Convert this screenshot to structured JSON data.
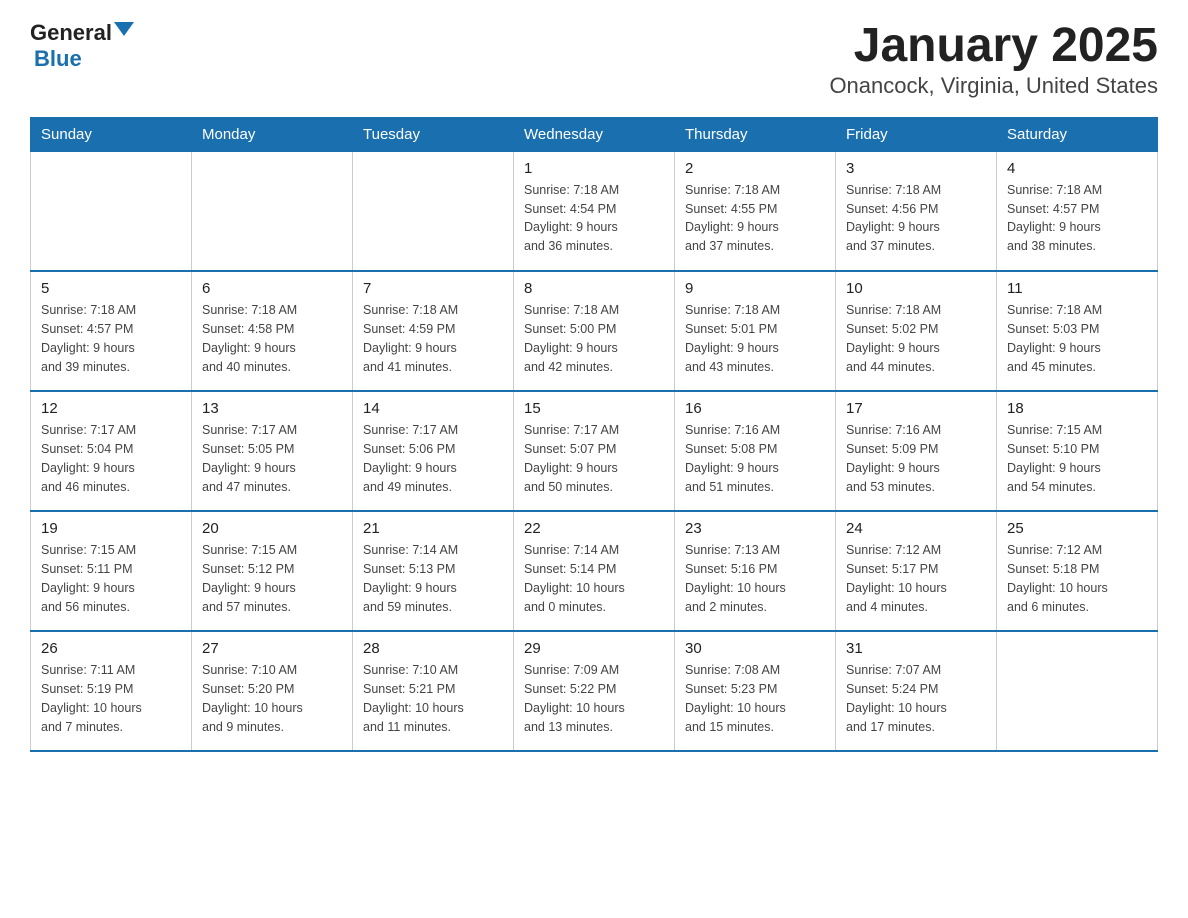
{
  "header": {
    "logo_text_general": "General",
    "logo_text_blue": "Blue",
    "title": "January 2025",
    "subtitle": "Onancock, Virginia, United States"
  },
  "calendar": {
    "days_of_week": [
      "Sunday",
      "Monday",
      "Tuesday",
      "Wednesday",
      "Thursday",
      "Friday",
      "Saturday"
    ],
    "weeks": [
      [
        {
          "day": "",
          "info": ""
        },
        {
          "day": "",
          "info": ""
        },
        {
          "day": "",
          "info": ""
        },
        {
          "day": "1",
          "info": "Sunrise: 7:18 AM\nSunset: 4:54 PM\nDaylight: 9 hours\nand 36 minutes."
        },
        {
          "day": "2",
          "info": "Sunrise: 7:18 AM\nSunset: 4:55 PM\nDaylight: 9 hours\nand 37 minutes."
        },
        {
          "day": "3",
          "info": "Sunrise: 7:18 AM\nSunset: 4:56 PM\nDaylight: 9 hours\nand 37 minutes."
        },
        {
          "day": "4",
          "info": "Sunrise: 7:18 AM\nSunset: 4:57 PM\nDaylight: 9 hours\nand 38 minutes."
        }
      ],
      [
        {
          "day": "5",
          "info": "Sunrise: 7:18 AM\nSunset: 4:57 PM\nDaylight: 9 hours\nand 39 minutes."
        },
        {
          "day": "6",
          "info": "Sunrise: 7:18 AM\nSunset: 4:58 PM\nDaylight: 9 hours\nand 40 minutes."
        },
        {
          "day": "7",
          "info": "Sunrise: 7:18 AM\nSunset: 4:59 PM\nDaylight: 9 hours\nand 41 minutes."
        },
        {
          "day": "8",
          "info": "Sunrise: 7:18 AM\nSunset: 5:00 PM\nDaylight: 9 hours\nand 42 minutes."
        },
        {
          "day": "9",
          "info": "Sunrise: 7:18 AM\nSunset: 5:01 PM\nDaylight: 9 hours\nand 43 minutes."
        },
        {
          "day": "10",
          "info": "Sunrise: 7:18 AM\nSunset: 5:02 PM\nDaylight: 9 hours\nand 44 minutes."
        },
        {
          "day": "11",
          "info": "Sunrise: 7:18 AM\nSunset: 5:03 PM\nDaylight: 9 hours\nand 45 minutes."
        }
      ],
      [
        {
          "day": "12",
          "info": "Sunrise: 7:17 AM\nSunset: 5:04 PM\nDaylight: 9 hours\nand 46 minutes."
        },
        {
          "day": "13",
          "info": "Sunrise: 7:17 AM\nSunset: 5:05 PM\nDaylight: 9 hours\nand 47 minutes."
        },
        {
          "day": "14",
          "info": "Sunrise: 7:17 AM\nSunset: 5:06 PM\nDaylight: 9 hours\nand 49 minutes."
        },
        {
          "day": "15",
          "info": "Sunrise: 7:17 AM\nSunset: 5:07 PM\nDaylight: 9 hours\nand 50 minutes."
        },
        {
          "day": "16",
          "info": "Sunrise: 7:16 AM\nSunset: 5:08 PM\nDaylight: 9 hours\nand 51 minutes."
        },
        {
          "day": "17",
          "info": "Sunrise: 7:16 AM\nSunset: 5:09 PM\nDaylight: 9 hours\nand 53 minutes."
        },
        {
          "day": "18",
          "info": "Sunrise: 7:15 AM\nSunset: 5:10 PM\nDaylight: 9 hours\nand 54 minutes."
        }
      ],
      [
        {
          "day": "19",
          "info": "Sunrise: 7:15 AM\nSunset: 5:11 PM\nDaylight: 9 hours\nand 56 minutes."
        },
        {
          "day": "20",
          "info": "Sunrise: 7:15 AM\nSunset: 5:12 PM\nDaylight: 9 hours\nand 57 minutes."
        },
        {
          "day": "21",
          "info": "Sunrise: 7:14 AM\nSunset: 5:13 PM\nDaylight: 9 hours\nand 59 minutes."
        },
        {
          "day": "22",
          "info": "Sunrise: 7:14 AM\nSunset: 5:14 PM\nDaylight: 10 hours\nand 0 minutes."
        },
        {
          "day": "23",
          "info": "Sunrise: 7:13 AM\nSunset: 5:16 PM\nDaylight: 10 hours\nand 2 minutes."
        },
        {
          "day": "24",
          "info": "Sunrise: 7:12 AM\nSunset: 5:17 PM\nDaylight: 10 hours\nand 4 minutes."
        },
        {
          "day": "25",
          "info": "Sunrise: 7:12 AM\nSunset: 5:18 PM\nDaylight: 10 hours\nand 6 minutes."
        }
      ],
      [
        {
          "day": "26",
          "info": "Sunrise: 7:11 AM\nSunset: 5:19 PM\nDaylight: 10 hours\nand 7 minutes."
        },
        {
          "day": "27",
          "info": "Sunrise: 7:10 AM\nSunset: 5:20 PM\nDaylight: 10 hours\nand 9 minutes."
        },
        {
          "day": "28",
          "info": "Sunrise: 7:10 AM\nSunset: 5:21 PM\nDaylight: 10 hours\nand 11 minutes."
        },
        {
          "day": "29",
          "info": "Sunrise: 7:09 AM\nSunset: 5:22 PM\nDaylight: 10 hours\nand 13 minutes."
        },
        {
          "day": "30",
          "info": "Sunrise: 7:08 AM\nSunset: 5:23 PM\nDaylight: 10 hours\nand 15 minutes."
        },
        {
          "day": "31",
          "info": "Sunrise: 7:07 AM\nSunset: 5:24 PM\nDaylight: 10 hours\nand 17 minutes."
        },
        {
          "day": "",
          "info": ""
        }
      ]
    ]
  }
}
